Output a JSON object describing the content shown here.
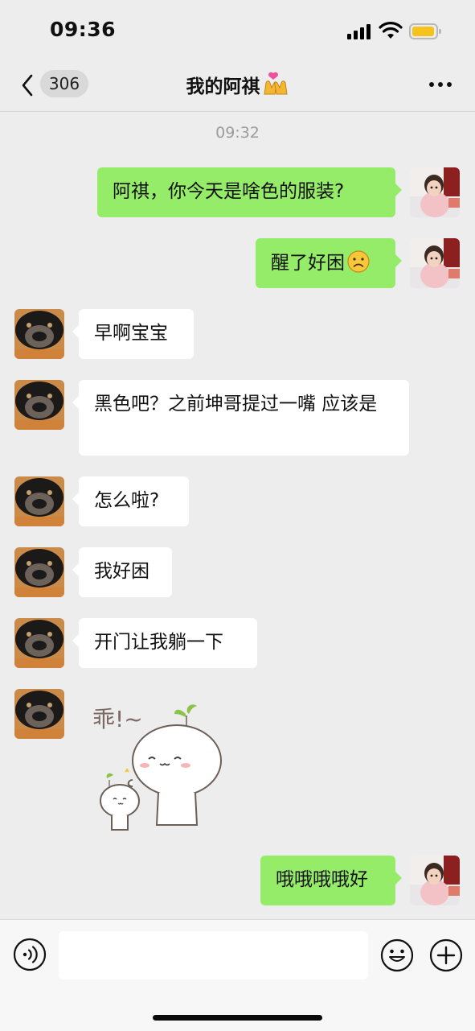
{
  "status_bar": {
    "time": "09:36",
    "battery_color": "#f6c21c"
  },
  "nav": {
    "unread_count": "306",
    "title": "我的阿祺",
    "title_emoji": "hands-heart-emoji"
  },
  "timestamp": "09:32",
  "messages": [
    {
      "direction": "outgoing",
      "type": "text",
      "text": "阿祺，你今天是啥色的服装?"
    },
    {
      "direction": "outgoing",
      "type": "text",
      "text": "醒了好困",
      "emoji": "sad-face-emoji"
    },
    {
      "direction": "incoming",
      "type": "text",
      "text": "早啊宝宝"
    },
    {
      "direction": "incoming",
      "type": "text",
      "text": "黑色吧？之前坤哥提过一嘴 应该是"
    },
    {
      "direction": "incoming",
      "type": "text",
      "text": "怎么啦?"
    },
    {
      "direction": "incoming",
      "type": "text",
      "text": "我好困"
    },
    {
      "direction": "incoming",
      "type": "text",
      "text": "开门让我躺一下"
    },
    {
      "direction": "incoming",
      "type": "sticker",
      "sticker_text": "乖!~"
    },
    {
      "direction": "outgoing",
      "type": "text",
      "text": "哦哦哦哦好"
    }
  ],
  "input_bar": {
    "voice_icon": "voice-icon",
    "emoji_icon": "emoji-icon",
    "plus_icon": "plus-icon"
  },
  "colors": {
    "outgoing_bubble": "#95ec69",
    "incoming_bubble": "#ffffff",
    "background": "#ededed"
  }
}
